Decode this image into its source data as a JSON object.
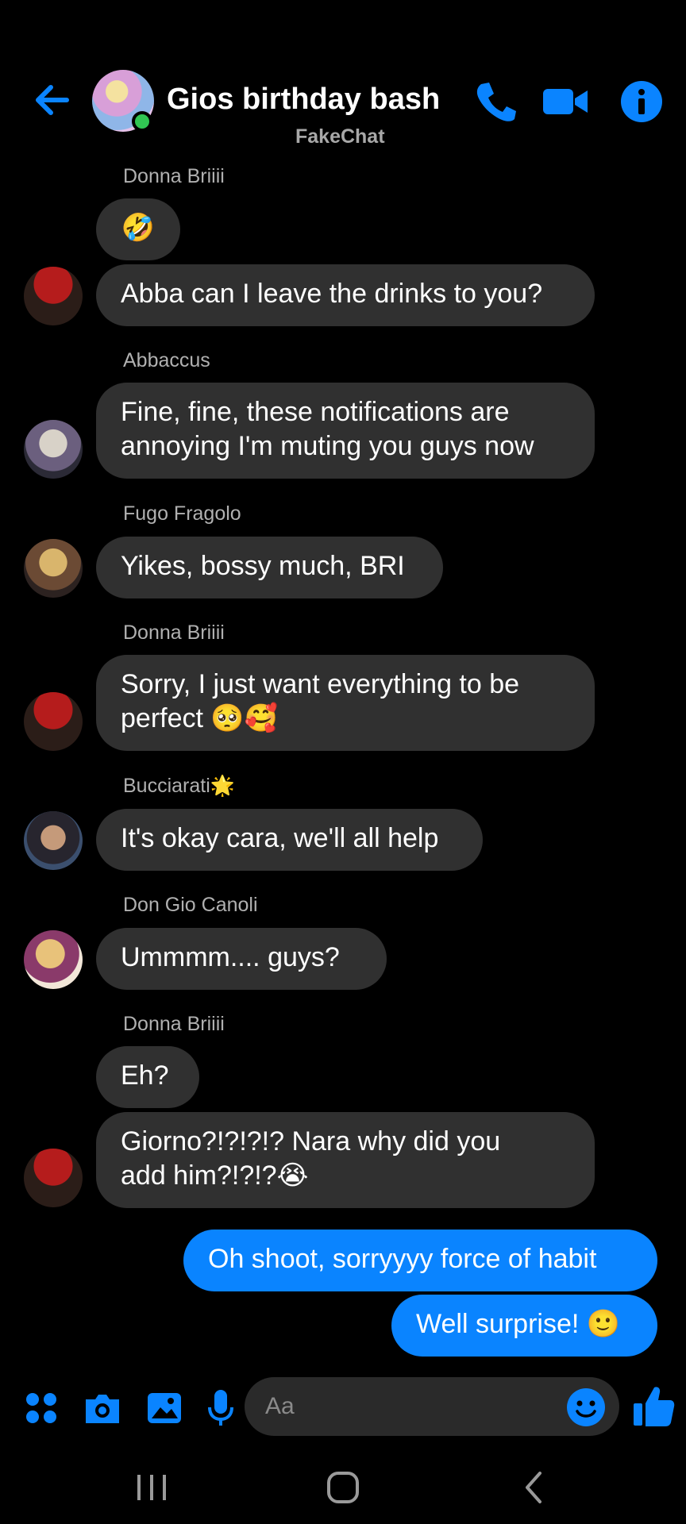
{
  "header": {
    "title": "Gios birthday bash",
    "subtitle": "FakeChat",
    "accent_color": "#0a84ff",
    "icons": [
      "back-arrow-icon",
      "phone-icon",
      "video-camera-icon",
      "info-icon"
    ]
  },
  "messages": [
    {
      "sender": "Donna Briiii",
      "text": "🤣"
    },
    {
      "text": "Abba can I leave the drinks to you?"
    },
    {
      "sender": "Abbaccus",
      "lines": [
        "Fine, fine, these notifications are",
        "annoying I'm muting you guys now"
      ]
    },
    {
      "sender": "Fugo Fragolo",
      "text": "Yikes, bossy much, BRI"
    },
    {
      "sender": "Donna Briiii",
      "lines": [
        "Sorry, I just want everything to be",
        "perfect 🥺🥰"
      ]
    },
    {
      "sender": "Bucciarati🌟",
      "text": "It's okay cara, we'll all help"
    },
    {
      "sender": "Don Gio Canoli",
      "text": "Ummmm.... guys?"
    },
    {
      "sender": "Donna Briiii",
      "text": "Eh?"
    },
    {
      "lines": [
        "Giorno?!?!?!?  Nara why did you",
        "add him?!?!?😭"
      ]
    },
    {
      "text": "Oh shoot, sorryyyy force of habit",
      "outgoing": true
    },
    {
      "text": "Well surprise! 🙂",
      "outgoing": true
    }
  ],
  "composer": {
    "placeholder": "Aa",
    "icons": [
      "apps-grid-icon",
      "camera-icon",
      "gallery-icon",
      "microphone-icon",
      "emoji-icon",
      "thumbs-up-icon"
    ]
  },
  "navbar": {
    "icons": [
      "recent-apps-icon",
      "home-icon",
      "back-icon"
    ]
  }
}
